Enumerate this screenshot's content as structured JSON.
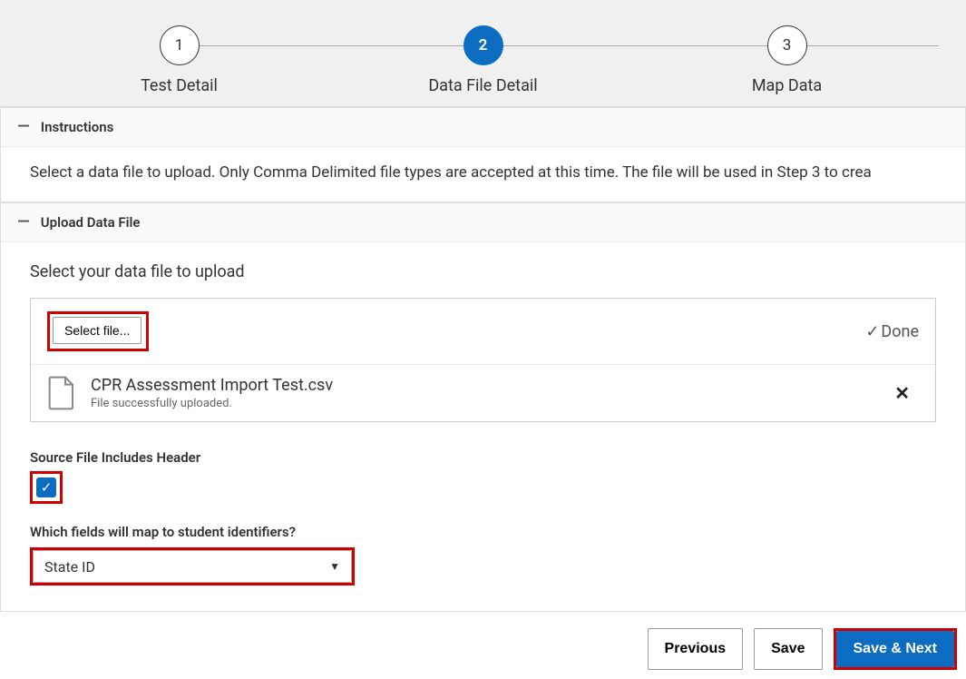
{
  "stepper": {
    "steps": [
      {
        "num": "1",
        "label": "Test Detail"
      },
      {
        "num": "2",
        "label": "Data File Detail"
      },
      {
        "num": "3",
        "label": "Map Data"
      }
    ]
  },
  "instructions": {
    "title": "Instructions",
    "body": "Select a data file to upload. Only Comma Delimited file types are accepted at this time. The file will be used in Step 3 to crea"
  },
  "upload": {
    "title": "Upload Data File",
    "prompt": "Select your data file to upload",
    "select_file_label": "Select file...",
    "done_label": "Done",
    "file": {
      "name": "CPR Assessment Import Test.csv",
      "status": "File successfully uploaded."
    },
    "header_checkbox_label": "Source File Includes Header",
    "map_question": "Which fields will map to student identifiers?",
    "map_selected": "State ID"
  },
  "footer": {
    "previous": "Previous",
    "save": "Save",
    "save_next": "Save & Next"
  }
}
